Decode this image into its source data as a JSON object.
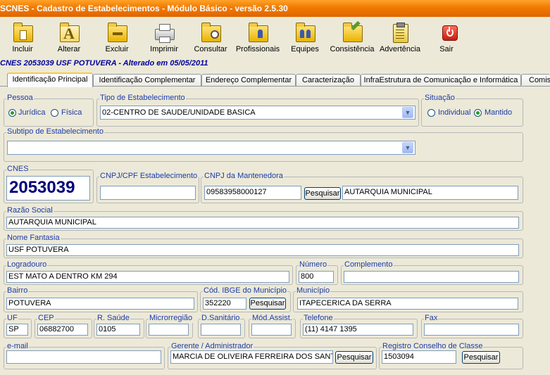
{
  "window": {
    "title": "SCNES - Cadastro de Estabelecimentos - Módulo Básico - versão 2.5.30"
  },
  "toolbar": {
    "incluir": "Incluir",
    "alterar": "Alterar",
    "excluir": "Excluir",
    "imprimir": "Imprimir",
    "consultar": "Consultar",
    "profissionais": "Profissionais",
    "equipes": "Equipes",
    "consistencia": "Consistência",
    "advertencia": "Advertência",
    "sair": "Sair"
  },
  "record_header": "CNES 2053039  USF POTUVERA - Alterado em 05/05/2011",
  "tabs": [
    {
      "label": "Identificação Principal"
    },
    {
      "label": "Identificação Complementar"
    },
    {
      "label": "Endereço Complementar"
    },
    {
      "label": "Caracterização"
    },
    {
      "label": "InfraEstrutura de Comunicação e Informática"
    },
    {
      "label": "Comis"
    }
  ],
  "pessoa": {
    "caption": "Pessoa",
    "juridica": "Jurídica",
    "fisica": "Física",
    "selected": "Jurídica"
  },
  "tipo": {
    "caption": "Tipo de Estabelecimento",
    "value": "02-CENTRO DE SAUDE/UNIDADE BASICA"
  },
  "situacao": {
    "caption": "Situação",
    "individual": "Individual",
    "mantido": "Mantido",
    "selected": "Mantido"
  },
  "subtipo": {
    "caption": "Subtipo de Estabelecimento",
    "value": ""
  },
  "cnes": {
    "caption": "CNES",
    "value": "2053039"
  },
  "cnpj_estab": {
    "caption": "CNPJ/CPF Estabelecimento",
    "value": ""
  },
  "cnpj_mant": {
    "caption": "CNPJ da Mantenedora",
    "value": "09583958000127",
    "button": "Pesquisar",
    "name": "AUTARQUIA MUNICIPAL"
  },
  "razao": {
    "caption": "Razão Social",
    "value": "AUTARQUIA MUNICIPAL"
  },
  "fantasia": {
    "caption": "Nome Fantasia",
    "value": "USF POTUVERA"
  },
  "logradouro": {
    "caption": "Logradouro",
    "value": "EST MATO A DENTRO KM 294"
  },
  "numero": {
    "caption": "Número",
    "value": "800"
  },
  "complemento": {
    "caption": "Complemento",
    "value": ""
  },
  "bairro": {
    "caption": "Bairro",
    "value": "POTUVERA"
  },
  "ibge": {
    "caption": "Cód. IBGE do Município",
    "value": "352220",
    "button": "Pesquisar"
  },
  "municipio": {
    "caption": "Município",
    "value": "ITAPECERICA DA SERRA"
  },
  "uf": {
    "caption": "UF",
    "value": "SP"
  },
  "cep": {
    "caption": "CEP",
    "value": "06882700"
  },
  "rsaude": {
    "caption": "R. Saúde",
    "value": "0105"
  },
  "microrregiao": {
    "caption": "Microrregião",
    "value": ""
  },
  "dsanitario": {
    "caption": "D.Sanitário",
    "value": ""
  },
  "modassist": {
    "caption": "Mód.Assist.",
    "value": ""
  },
  "telefone": {
    "caption": "Telefone",
    "value": "(11) 4147 1395"
  },
  "fax": {
    "caption": "Fax",
    "value": ""
  },
  "email": {
    "caption": "e-mail",
    "value": ""
  },
  "gerente": {
    "caption": "Gerente / Administrador",
    "value": "MARCIA DE OLIVEIRA FERREIRA DOS SANT",
    "button": "Pesquisar"
  },
  "registro": {
    "caption": "Registro Conselho de Classe",
    "value": "1503094",
    "button": "Pesquisar"
  }
}
